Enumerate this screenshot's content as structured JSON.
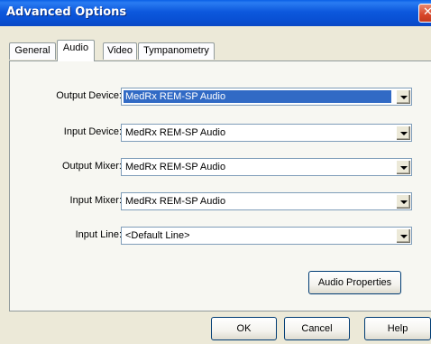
{
  "window": {
    "title": "Advanced Options",
    "close_glyph": "✕"
  },
  "tabs": [
    {
      "label": "General",
      "active": false
    },
    {
      "label": "Audio",
      "active": true
    },
    {
      "label": "Video",
      "active": false
    },
    {
      "label": "Tympanometry",
      "active": false
    }
  ],
  "audio": {
    "output_device": {
      "label": "Output Device:",
      "value": "MedRx REM-SP Audio"
    },
    "input_device": {
      "label": "Input Device:",
      "value": "MedRx REM-SP Audio"
    },
    "output_mixer": {
      "label": "Output Mixer:",
      "value": "MedRx REM-SP Audio"
    },
    "input_mixer": {
      "label": "Input Mixer:",
      "value": "MedRx REM-SP Audio"
    },
    "input_line": {
      "label": "Input Line:",
      "value": "<Default Line>"
    },
    "properties_button": "Audio Properties"
  },
  "footer": {
    "ok": "OK",
    "cancel": "Cancel",
    "help": "Help"
  },
  "icons": {
    "close": "close-icon",
    "dropdown": "chevron-down-icon"
  }
}
